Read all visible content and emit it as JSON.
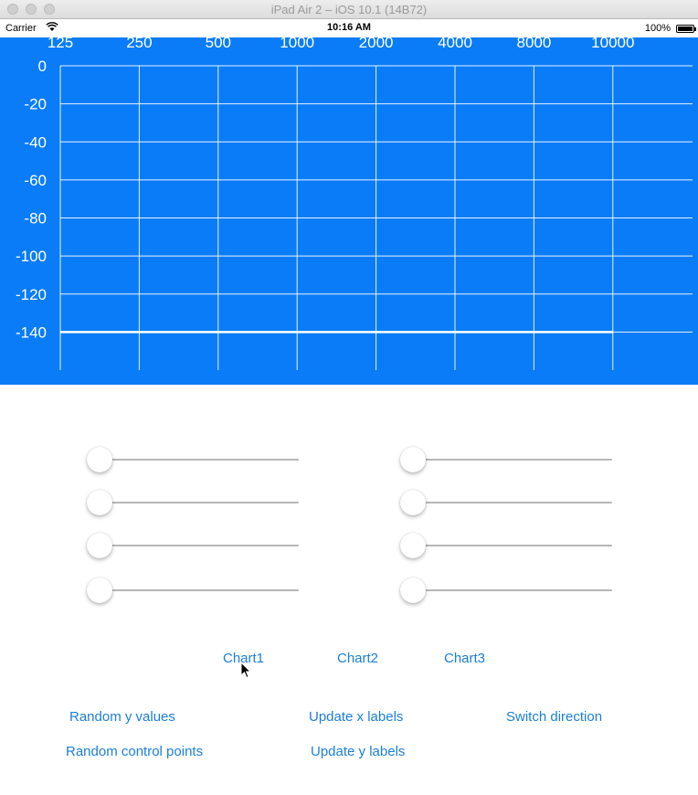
{
  "window": {
    "title": "iPad Air 2 – iOS 10.1 (14B72)"
  },
  "status_bar": {
    "carrier": "Carrier",
    "time": "10:16 AM",
    "battery": "100%"
  },
  "chart_data": {
    "type": "line",
    "x_tick_labels": [
      "125",
      "250",
      "500",
      "1000",
      "2000",
      "4000",
      "8000",
      "10000"
    ],
    "y_tick_labels": [
      "0",
      "-20",
      "-40",
      "-60",
      "-80",
      "-100",
      "-120",
      "-140"
    ],
    "ylim": [
      -160,
      0
    ],
    "grid": true,
    "background": "#0a7cf7",
    "series": [
      {
        "x": [
          "125",
          "250",
          "500",
          "1000",
          "2000",
          "4000",
          "8000",
          "10000"
        ],
        "values": [
          -140,
          -140,
          -140,
          -140,
          -140,
          -140,
          -140,
          -140
        ]
      }
    ]
  },
  "sliders": {
    "left": [
      0,
      0,
      0,
      0
    ],
    "right": [
      0,
      0,
      0,
      0
    ]
  },
  "chart_buttons": [
    "Chart1",
    "Chart2",
    "Chart3"
  ],
  "actions": {
    "random_y": "Random y values",
    "update_x": "Update x labels",
    "switch_direction": "Switch direction",
    "random_control": "Random control points",
    "update_y": "Update y labels"
  },
  "colors": {
    "accent": "#1a7fd8",
    "chart_bg": "#0a7cf7",
    "grid": "#ffffff"
  }
}
